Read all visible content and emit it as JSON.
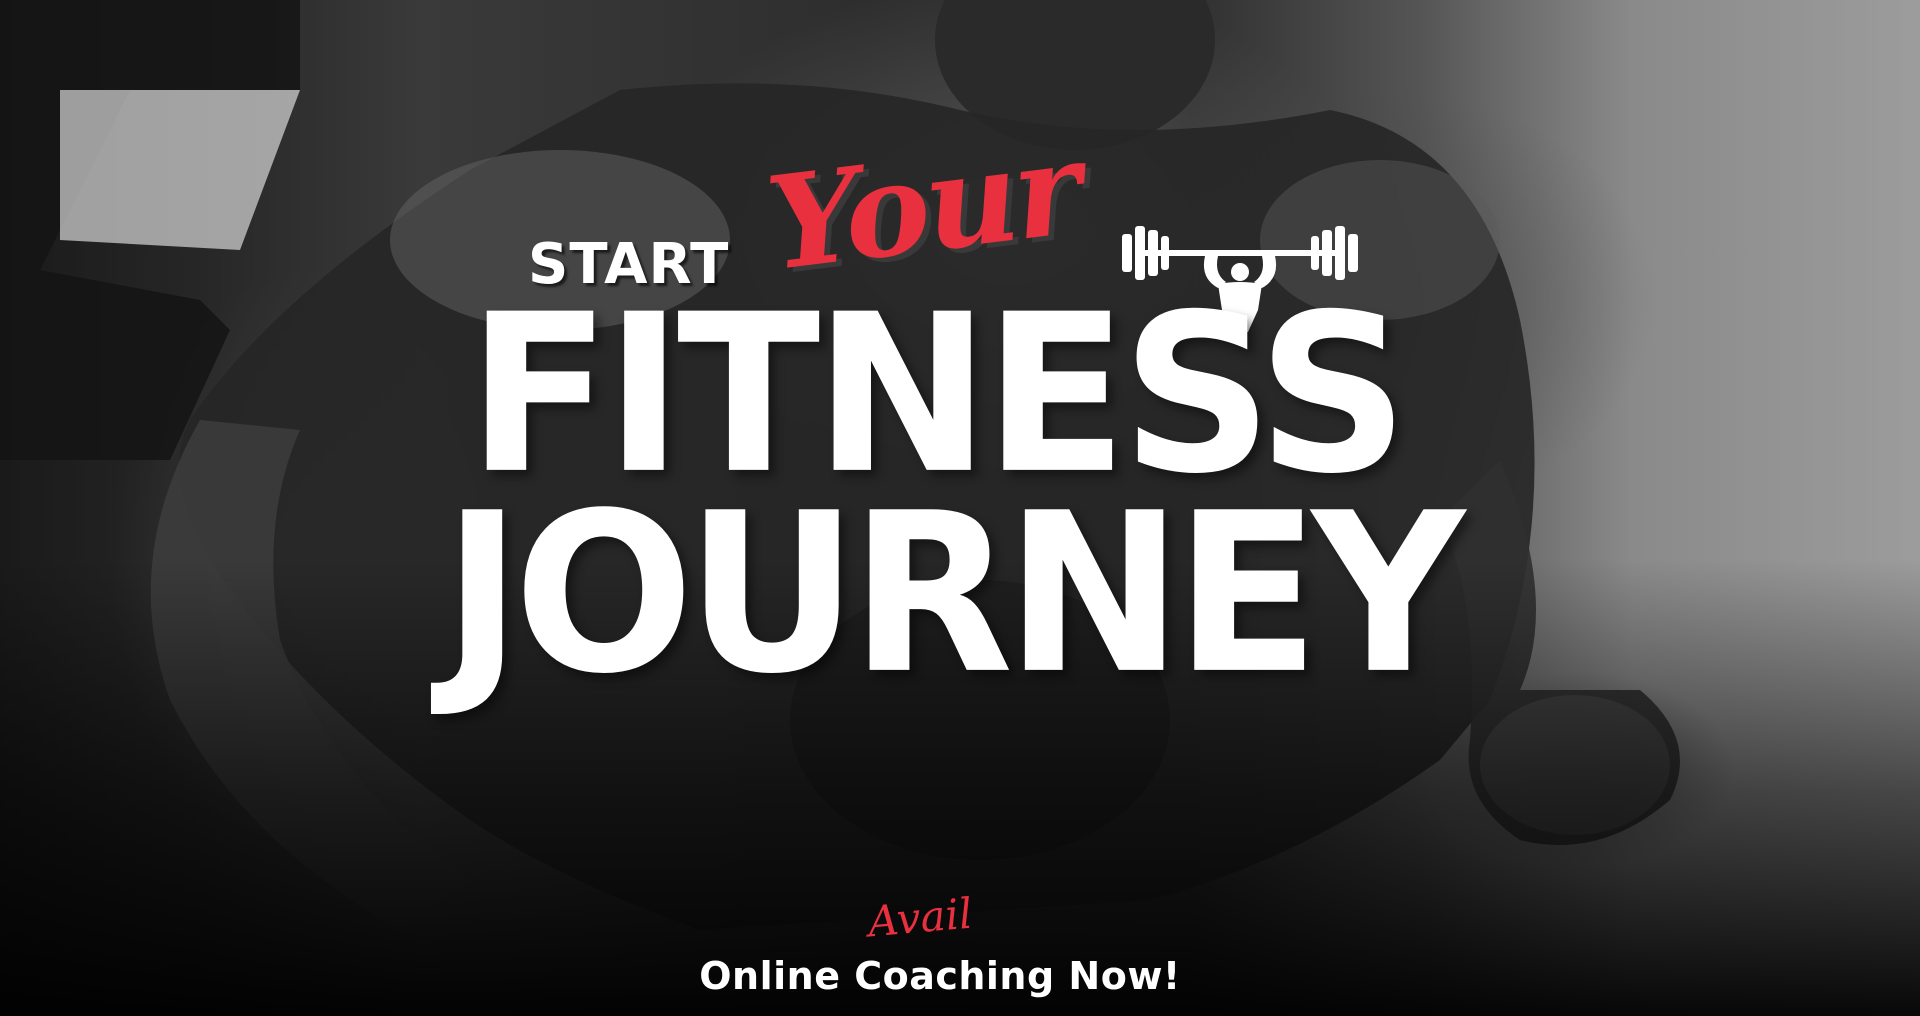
{
  "banner": {
    "headline_start": "START",
    "headline_script": "Your",
    "headline_line1": "FITNESS",
    "headline_line2": "JOURNEY",
    "cta_script": "Avail",
    "cta_text": "Online Coaching Now!"
  },
  "icons": {
    "logo": "weightlifter-barbell-icon"
  },
  "colors": {
    "accent": "#e8303f",
    "headline": "#ffffff",
    "background": "#2e2e2e"
  }
}
